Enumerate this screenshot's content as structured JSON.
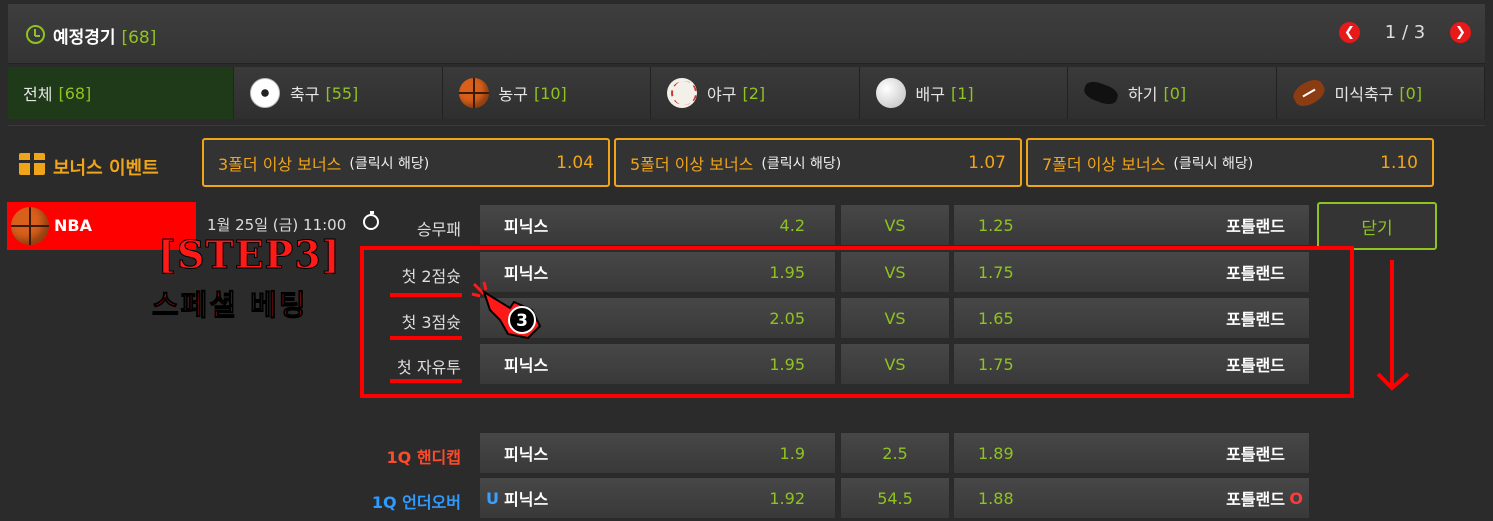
{
  "header": {
    "title": "예정경기",
    "count": "[68]",
    "page": "1 / 3",
    "prev": "❮",
    "next": "❯"
  },
  "tabs": [
    {
      "label": "전체",
      "count": "[68]",
      "icon": "none"
    },
    {
      "label": "축구",
      "count": "[55]",
      "icon": "soccer-ball-icon"
    },
    {
      "label": "농구",
      "count": "[10]",
      "icon": "basketball-icon"
    },
    {
      "label": "야구",
      "count": "[2]",
      "icon": "baseball-icon"
    },
    {
      "label": "배구",
      "count": "[1]",
      "icon": "volleyball-icon"
    },
    {
      "label": "하기",
      "count": "[0]",
      "icon": "hockey-puck-icon"
    },
    {
      "label": "미식축구",
      "count": "[0]",
      "icon": "american-football-icon"
    }
  ],
  "bonus": {
    "title": "보너스 이벤트",
    "items": [
      {
        "label": "3폴더 이상 보너스",
        "sub": "(클릭시 해당)",
        "value": "1.04"
      },
      {
        "label": "5폴더 이상 보너스",
        "sub": "(클릭시 해당)",
        "value": "1.07"
      },
      {
        "label": "7폴더 이상 보너스",
        "sub": "(클릭시 해당)",
        "value": "1.10"
      }
    ]
  },
  "match": {
    "league": "NBA",
    "time": "1월 25일 (금) 11:00",
    "close": "닫기",
    "rows": [
      {
        "label": "승무패",
        "home": "피닉스",
        "home_odds": "4.2",
        "mid": "VS",
        "away_odds": "1.25",
        "away": "포틀랜드"
      },
      {
        "label": "첫 2점슛",
        "home": "피닉스",
        "home_odds": "1.95",
        "mid": "VS",
        "away_odds": "1.75",
        "away": "포틀랜드"
      },
      {
        "label": "첫 3점슛",
        "home": "",
        "home_odds": "2.05",
        "mid": "VS",
        "away_odds": "1.65",
        "away": "포틀랜드"
      },
      {
        "label": "첫 자유투",
        "home": "피닉스",
        "home_odds": "1.95",
        "mid": "VS",
        "away_odds": "1.75",
        "away": "포틀랜드"
      },
      {
        "label": "1Q 핸디캡",
        "home": "피닉스",
        "home_odds": "1.9",
        "mid": "2.5",
        "away_odds": "1.89",
        "away": "포틀랜드"
      },
      {
        "label": "1Q 언더오버",
        "home": "피닉스",
        "home_odds": "1.92",
        "mid": "54.5",
        "away_odds": "1.88",
        "away": "포틀랜드",
        "u": "U",
        "o": "O"
      }
    ]
  },
  "annotation": {
    "step": "[STEP3]",
    "sub": "스페셜 베팅",
    "number": "3"
  },
  "colors": {
    "accent": "#8fc31f",
    "bonus": "#f0a419",
    "highlight": "#ff0000"
  }
}
